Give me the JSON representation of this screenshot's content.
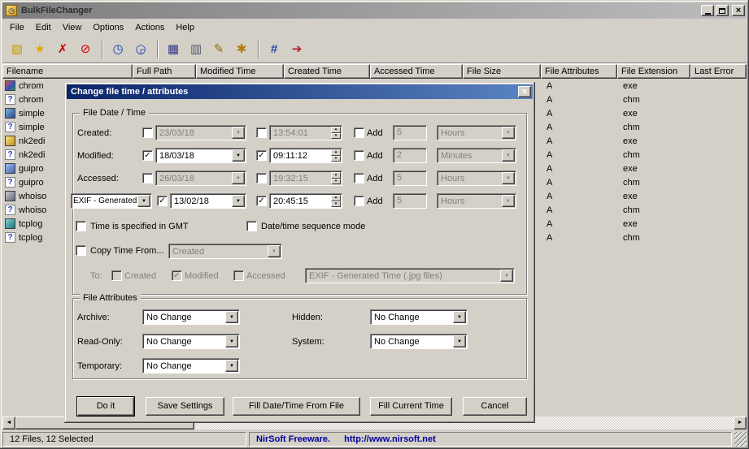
{
  "titlebar": {
    "title": "BulkFileChanger",
    "close_glyph": "×"
  },
  "menu": {
    "items": [
      "File",
      "Edit",
      "View",
      "Options",
      "Actions",
      "Help"
    ]
  },
  "toolbar": {
    "icons": [
      {
        "name": "open-files-icon",
        "glyph": "▨"
      },
      {
        "name": "add-files-icon",
        "glyph": "★"
      },
      {
        "name": "remove-files-icon",
        "glyph": "✗"
      },
      {
        "name": "stop-icon",
        "glyph": "⊘"
      },
      {
        "name": "change-time-icon",
        "glyph": "◷"
      },
      {
        "name": "copy-time-icon",
        "glyph": "◶"
      },
      {
        "name": "save-icon",
        "glyph": "▦"
      },
      {
        "name": "copy-icon",
        "glyph": "▥"
      },
      {
        "name": "report-icon",
        "glyph": "✎"
      },
      {
        "name": "properties-icon",
        "glyph": "✱"
      },
      {
        "name": "advanced-options-icon",
        "glyph": "#"
      },
      {
        "name": "exit-icon",
        "glyph": "➔"
      }
    ]
  },
  "listview": {
    "columns": [
      "Filename",
      "Full Path",
      "Modified Time",
      "Created Time",
      "Accessed Time",
      "File Size",
      "File Attributes",
      "File Extension",
      "Last Error"
    ],
    "help_glyph": "?",
    "rows": [
      {
        "name": "chrom",
        "attr": "A",
        "ext": "exe"
      },
      {
        "name": "chrom",
        "attr": "A",
        "ext": "chm"
      },
      {
        "name": "simple",
        "attr": "A",
        "ext": "exe"
      },
      {
        "name": "simple",
        "attr": "A",
        "ext": "chm"
      },
      {
        "name": "nk2edi",
        "attr": "A",
        "ext": "exe"
      },
      {
        "name": "nk2edi",
        "attr": "A",
        "ext": "chm"
      },
      {
        "name": "guipro",
        "attr": "A",
        "ext": "exe"
      },
      {
        "name": "guipro",
        "attr": "A",
        "ext": "chm"
      },
      {
        "name": "whoiso",
        "attr": "A",
        "ext": "exe"
      },
      {
        "name": "whoiso",
        "attr": "A",
        "ext": "chm"
      },
      {
        "name": "tcplog",
        "attr": "A",
        "ext": "exe"
      },
      {
        "name": "tcplog",
        "attr": "A",
        "ext": "chm"
      }
    ]
  },
  "hscrollbar": {
    "left_arrow": "◄",
    "right_arrow": "►"
  },
  "statusbar": {
    "files_info": "12 Files, 12 Selected",
    "brand": "NirSoft Freeware.",
    "url": "http://www.nirsoft.net"
  },
  "dialog": {
    "title": "Change file time / attributes",
    "close_glyph": "×",
    "datetime_group": {
      "legend": "File Date / Time",
      "rows": {
        "created": {
          "label": "Created:",
          "date_cb": "",
          "date": "23/03/18",
          "time_cb": "",
          "time": "13:54:01",
          "add_cb": "",
          "add_label": "Add",
          "qty": "5",
          "unit": "Hours"
        },
        "modified": {
          "label": "Modified:",
          "date_cb": "✓",
          "date": "18/03/18",
          "time_cb": "✓",
          "time": "09:11:12",
          "add_cb": "",
          "add_label": "Add",
          "qty": "2",
          "unit": "Minutes"
        },
        "accessed": {
          "label": "Accessed:",
          "date_cb": "",
          "date": "26/03/18",
          "time_cb": "",
          "time": "19:32:15",
          "add_cb": "",
          "add_label": "Add",
          "qty": "5",
          "unit": "Hours"
        },
        "exif": {
          "label": "EXIF - Generated",
          "date_cb": "✓",
          "date": "13/02/18",
          "time_cb": "✓",
          "time": "20:45:15",
          "add_cb": "",
          "add_label": "Add",
          "qty": "5",
          "unit": "Hours"
        }
      },
      "gmt_cb": "",
      "gmt_label": "Time is specified in GMT",
      "sequence_cb": "",
      "sequence_label": "Date/time sequence mode",
      "copy_cb": "",
      "copy_label": "Copy Time From...",
      "copy_source": "Created",
      "to_label": "To:",
      "to_created_cb": "",
      "to_created_label": "Created",
      "to_modified_cb": "✓",
      "to_modified_label": "Modified",
      "to_accessed_cb": "",
      "to_accessed_label": "Accessed",
      "to_target": "EXIF - Generated Time (.jpg files)"
    },
    "attributes_group": {
      "legend": "File Attributes",
      "archive_label": "Archive:",
      "archive_value": "No Change",
      "hidden_label": "Hidden:",
      "hidden_value": "No Change",
      "readonly_label": "Read-Only:",
      "readonly_value": "No Change",
      "system_label": "System:",
      "system_value": "No Change",
      "temporary_label": "Temporary:",
      "temporary_value": "No Change"
    },
    "buttons": {
      "do_it": "Do it",
      "save_settings": "Save Settings",
      "fill_from_file": "Fill Date/Time From File",
      "fill_current": "Fill Current Time",
      "cancel": "Cancel"
    }
  }
}
